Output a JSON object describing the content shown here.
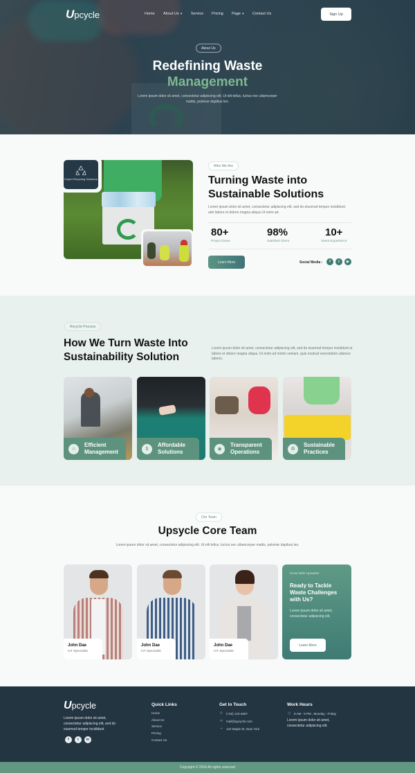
{
  "colors": {
    "brand_dark": "#243542",
    "brand_green": "#5d937e",
    "accent_green_text": "#7fb892",
    "process_bg": "#e9f1ef"
  },
  "nav": {
    "logo_mark": "U",
    "logo_text": "pcycle",
    "items": [
      {
        "label": "Home",
        "dropdown": false
      },
      {
        "label": "About Us",
        "dropdown": true
      },
      {
        "label": "Service",
        "dropdown": false
      },
      {
        "label": "Pricing",
        "dropdown": false
      },
      {
        "label": "Page",
        "dropdown": true
      },
      {
        "label": "Contact Us",
        "dropdown": false
      }
    ],
    "signup_label": "Sign Up"
  },
  "hero": {
    "badge": "About Us",
    "title_line1": "Redefining Waste",
    "title_line2": "Management",
    "description": "Lorem ipsum dolor sit amet, consectetur adipiscing elit. Ut elit tellus, luctus nec ullamcorper mattis, pulvinar dapibus leo."
  },
  "who": {
    "badge_card_label": "Expert Recycling Solutions",
    "tag": "Who We Are",
    "title": "Turning Waste into Sustainable Solutions",
    "description": "Lorem ipsum dolor sit amet, consectetur adipiscing elit, sed do eiusmod tempor incididunt utet labore et dolore magna aliqua Ut enim ad.",
    "stats": [
      {
        "value": "80+",
        "label": "Project Done"
      },
      {
        "value": "98%",
        "label": "Satisfied Client"
      },
      {
        "value": "10+",
        "label": "Years Experience"
      }
    ],
    "cta_label": "Learn More",
    "social_label": "Social Media :",
    "social_icons": [
      "facebook-icon",
      "twitter-icon",
      "youtube-icon"
    ]
  },
  "process": {
    "tag": "Recycle Process",
    "title": "How We Turn Waste Into Sustainability Solution",
    "description": "Lorem ipsum dolor sit amet, consectetur adipiscing elit, sed do eiusmod tempor incididunt ut labore et dolore magna aliqua. Ut enim ad minim veniam, quis nostrud exercitation ullamco laboris.",
    "cards": [
      {
        "line1": "Efficient",
        "line2": "Management",
        "icon": "user-gear-icon"
      },
      {
        "line1": "Affordable",
        "line2": "Solutions",
        "icon": "money-bag-icon"
      },
      {
        "line1": "Transparent",
        "line2": "Operations",
        "icon": "eye-icon"
      },
      {
        "line1": "Sustainable",
        "line2": "Practices",
        "icon": "leaf-cycle-icon"
      }
    ]
  },
  "team": {
    "tag": "Our Team",
    "title": "Upsycle Core Team",
    "description": "Lorem ipsum dolor sit amet, consectetur adipiscing elit. Ut elit tellus, luctus nec ullamcorper mattis, pulvinar dapibus leo.",
    "members": [
      {
        "name": "John Dae",
        "role": "IoT Specialist"
      },
      {
        "name": "John Dae",
        "role": "IoT Specialist"
      },
      {
        "name": "John Dae",
        "role": "IoT Specialist"
      }
    ],
    "cta": {
      "kicker": "Grow With Upwaste",
      "title": "Ready to Tackle Waste Challenges with Us?",
      "description": "Lorem ipsum dolor sit amet, consectetur adipiscing elit.",
      "button": "Learn More"
    }
  },
  "footer": {
    "logo_mark": "U",
    "logo_text": "pcycle",
    "description": "Lorem ipsum dolor sit amet, consectetur adipiscing elit, sed do eiusmod tempor incididunt",
    "social_icons": [
      "facebook-icon",
      "twitter-icon",
      "linkedin-icon"
    ],
    "quick_links_title": "Quick Links",
    "quick_links": [
      "Home",
      "About Us",
      "Service",
      "Pricing",
      "Contact Us"
    ],
    "contact_title": "Get In Touch",
    "phone": "(+62) 123-4567",
    "email": "mail@upcycle.com",
    "address": "122 Maple St, New York",
    "hours_title": "Work Hours",
    "hours": "8 AM - 5 PM , Monday - Friday",
    "hours_description": "Lorem ipsum dolor sit amet, consectetur adipiscing elit.",
    "copyright": "Copyright © 2024 All rights reserved"
  }
}
